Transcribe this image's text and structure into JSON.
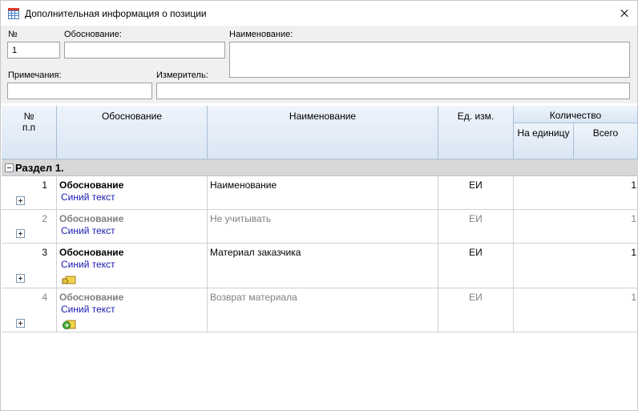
{
  "window": {
    "title": "Дополнительная информация о позиции",
    "app_icon": "table-grid-icon",
    "close_icon": "close-icon"
  },
  "form": {
    "number_label": "№",
    "number_value": "1",
    "basis_label": "Обоснование:",
    "basis_value": "",
    "name_label": "Наименование:",
    "name_value": "",
    "notes_label": "Примечания:",
    "notes_value": "",
    "unit_label": "Измеритель:",
    "unit_value": ""
  },
  "grid": {
    "columns": {
      "num_line1": "№",
      "num_line2": "п.п",
      "basis": "Обоснование",
      "name": "Наименование",
      "unit": "Ед. изм.",
      "qty": "Количество",
      "qty_per_unit": "На единицу",
      "qty_total": "Всего"
    },
    "section": {
      "label": "Раздел 1."
    },
    "rows": [
      {
        "num": "1",
        "basis": "Обоснование",
        "blue": "Синий текст",
        "name": "Наименование",
        "unit": "ЕИ",
        "qty_total": "1",
        "dim": false,
        "icon": ""
      },
      {
        "num": "2",
        "basis": "Обоснование",
        "blue": "Синий текст",
        "name": "Не учитывать",
        "unit": "ЕИ",
        "qty_total": "1",
        "dim": true,
        "icon": ""
      },
      {
        "num": "3",
        "basis": "Обоснование",
        "blue": "Синий текст",
        "name": "Материал заказчика",
        "unit": "ЕИ",
        "qty_total": "1",
        "dim": false,
        "icon": "customer-material-icon"
      },
      {
        "num": "4",
        "basis": "Обоснование",
        "blue": "Синий текст",
        "name": "Возврат материала",
        "unit": "ЕИ",
        "qty_total": "1",
        "dim": true,
        "icon": "material-return-icon"
      }
    ]
  }
}
